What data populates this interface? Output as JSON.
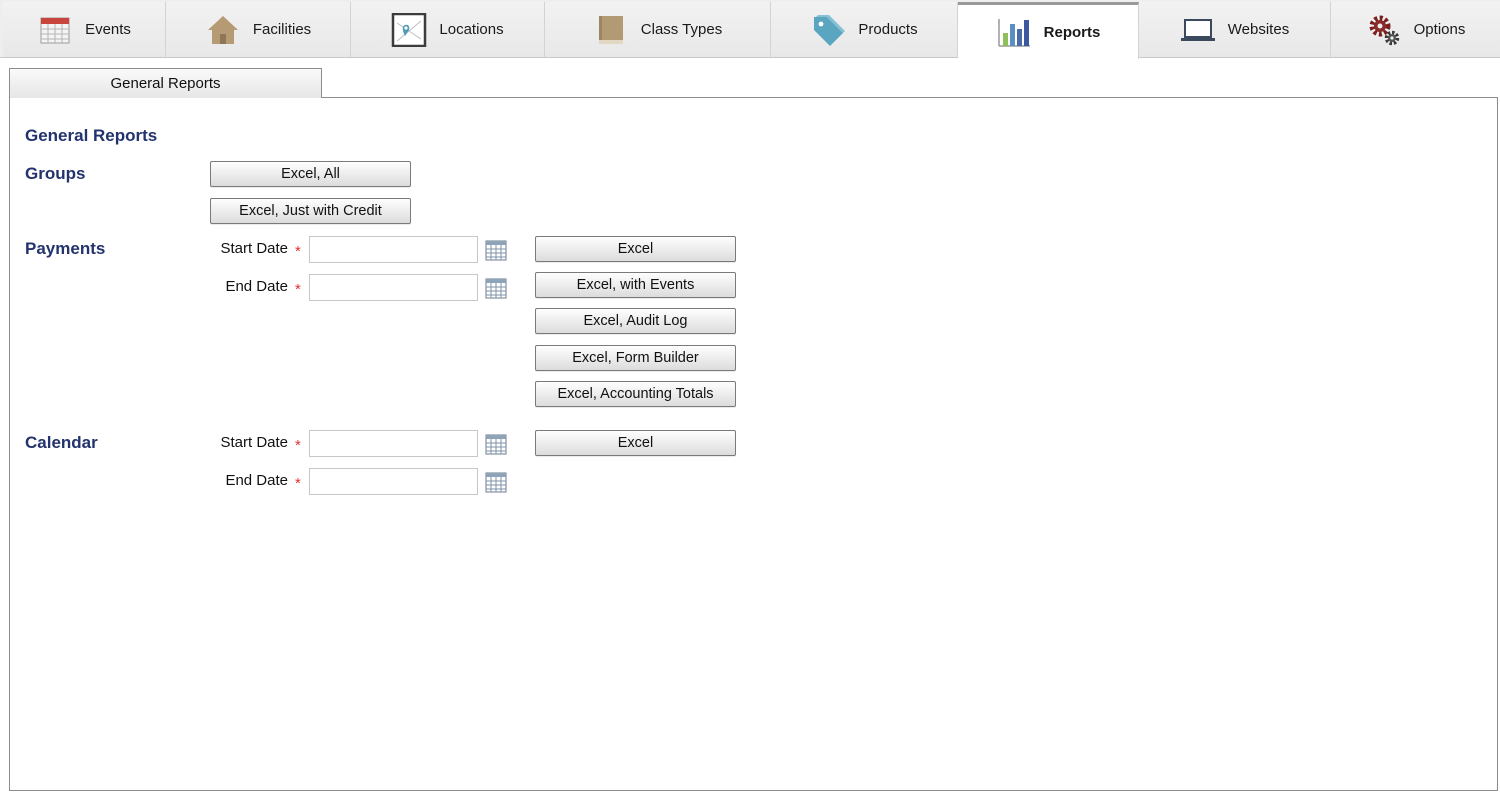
{
  "nav": {
    "tabs": [
      {
        "label": "Events",
        "icon": "calendar-icon"
      },
      {
        "label": "Facilities",
        "icon": "house-icon"
      },
      {
        "label": "Locations",
        "icon": "map-pin-icon"
      },
      {
        "label": "Class Types",
        "icon": "book-icon"
      },
      {
        "label": "Products",
        "icon": "tag-icon"
      },
      {
        "label": "Reports",
        "icon": "bar-chart-icon",
        "active": true
      },
      {
        "label": "Websites",
        "icon": "laptop-icon"
      },
      {
        "label": "Options",
        "icon": "gears-icon"
      }
    ]
  },
  "subtabs": [
    {
      "label": "General Reports",
      "active": true
    }
  ],
  "page": {
    "title": "General Reports"
  },
  "groups": {
    "heading": "Groups",
    "buttons": [
      "Excel, All",
      "Excel, Just with Credit"
    ]
  },
  "payments": {
    "heading": "Payments",
    "start_label": "Start Date",
    "end_label": "End Date",
    "required_mark": "*",
    "start_value": "",
    "end_value": "",
    "buttons": [
      "Excel",
      "Excel, with Events",
      "Excel, Audit Log",
      "Excel, Form Builder",
      "Excel, Accounting Totals"
    ]
  },
  "calendar": {
    "heading": "Calendar",
    "start_label": "Start Date",
    "end_label": "End Date",
    "required_mark": "*",
    "start_value": "",
    "end_value": "",
    "buttons": [
      "Excel"
    ]
  },
  "colors": {
    "heading": "#23336d",
    "required": "#dd3333",
    "nav_bg": "#eeeeee"
  }
}
